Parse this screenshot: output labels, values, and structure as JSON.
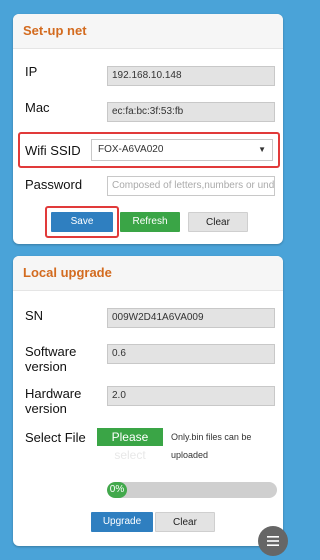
{
  "setup_net": {
    "title": "Set-up net",
    "ip_label": "IP",
    "ip_value": "192.168.10.148",
    "mac_label": "Mac",
    "mac_value": "ec:fa:bc:3f:53:fb",
    "wifi_label": "Wifi SSID",
    "wifi_value": "FOX-A6VA020",
    "password_label": "Password",
    "password_placeholder": "Composed of letters,numbers or unde",
    "save_label": "Save",
    "refresh_label": "Refresh",
    "clear_label": "Clear"
  },
  "local_upgrade": {
    "title": "Local upgrade",
    "sn_label": "SN",
    "sn_value": "009W2D41A6VA009",
    "software_label_1": "Software",
    "software_label_2": "version",
    "software_value": "0.6",
    "hardware_label_1": "Hardware",
    "hardware_label_2": "version",
    "hardware_value": "2.0",
    "select_file_label": "Select File",
    "select_button_line1": "Please",
    "select_button_line2": "select",
    "note_line1": "Only.bin files can be",
    "note_line2": "uploaded",
    "progress_text": "0%",
    "progress_value": 0,
    "upgrade_label": "Upgrade",
    "clear_label": "Clear"
  },
  "colors": {
    "page_bg": "#4aa3d8",
    "section_title": "#d36b1f",
    "primary_blue": "#2f7fc0",
    "success_green": "#3aa546",
    "highlight_red": "#e13a3a"
  },
  "icons": {
    "menu_fab": "menu-icon"
  }
}
